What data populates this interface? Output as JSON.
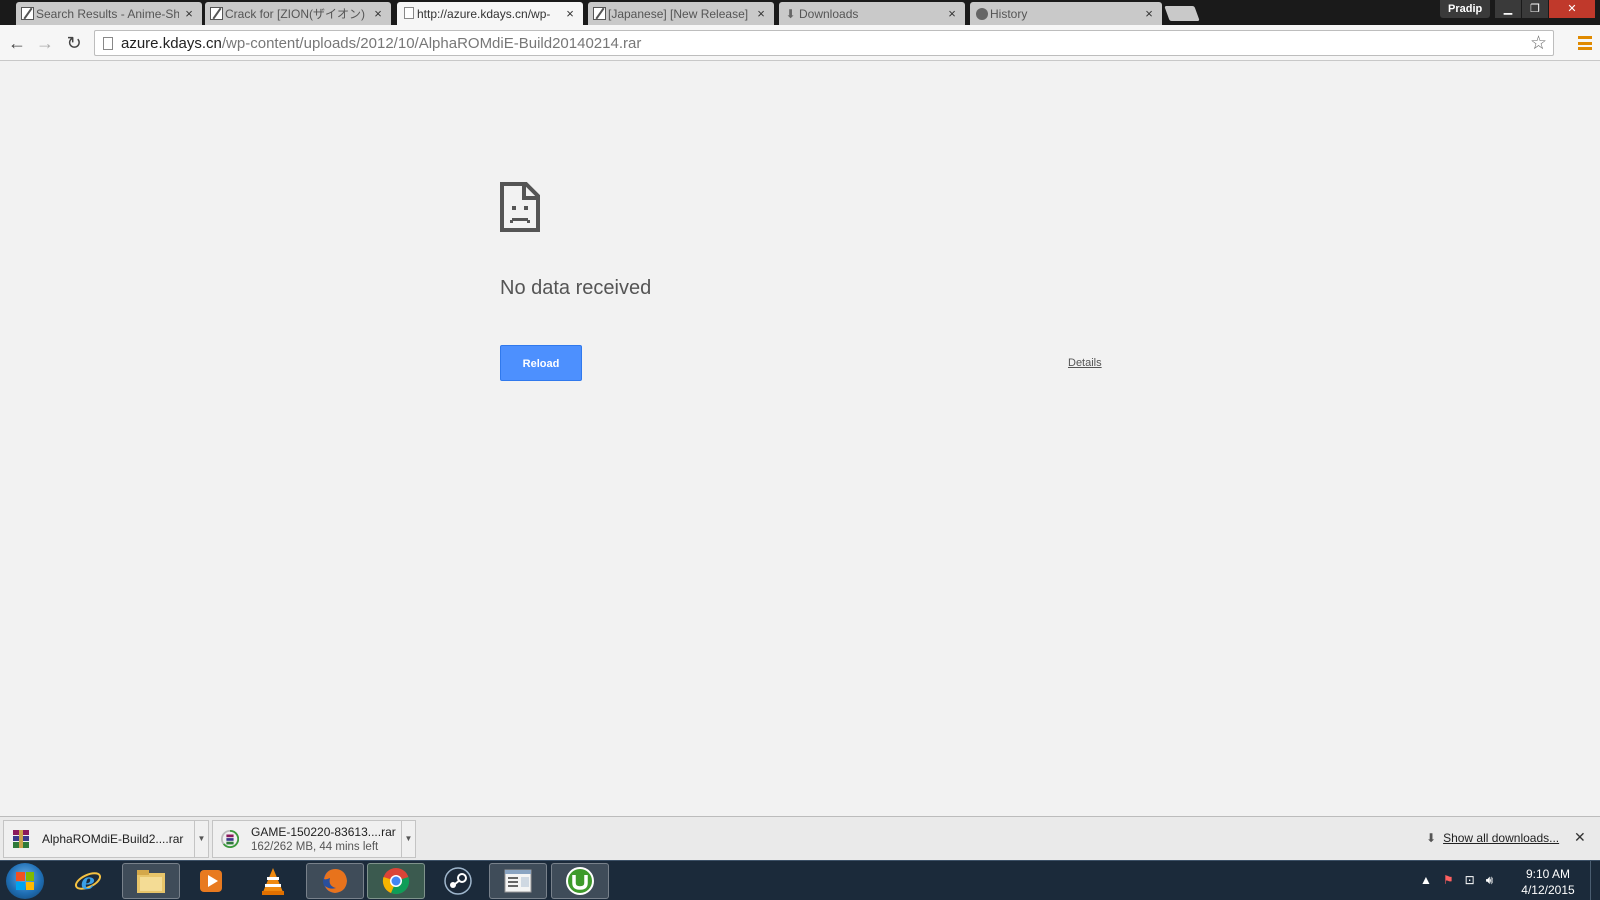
{
  "tabs": [
    {
      "title": "Search Results - Anime-Sh",
      "favicon": "z-logo-icon"
    },
    {
      "title": "Crack for [ZION(ザイオン)",
      "favicon": "z-logo-icon"
    },
    {
      "title": "http://azure.kdays.cn/wp-",
      "favicon": "page-icon",
      "active": true
    },
    {
      "title": "[Japanese] [New Release]",
      "favicon": "z-logo-icon"
    },
    {
      "title": "Downloads",
      "favicon": "download-icon"
    },
    {
      "title": "History",
      "favicon": "history-icon"
    }
  ],
  "profile_name": "Pradip",
  "omnibox": {
    "host": "azure.kdays.cn",
    "path": "/wp-content/uploads/2012/10/AlphaROMdiE-Build20140214.rar"
  },
  "error_page": {
    "title": "No data received",
    "reload_label": "Reload",
    "details_label": "Details"
  },
  "download_shelf": {
    "items": [
      {
        "name": "AlphaROMdiE-Build2....rar",
        "status": ""
      },
      {
        "name": "GAME-150220-83613....rar",
        "status": "162/262 MB, 44 mins left"
      }
    ],
    "show_all_label": "Show all downloads..."
  },
  "taskbar": {
    "apps": [
      "internet-explorer-icon",
      "file-explorer-icon",
      "media-player-icon",
      "vlc-icon",
      "firefox-icon",
      "chrome-icon",
      "steam-icon",
      "notepad-window-icon",
      "utorrent-icon"
    ],
    "time": "9:10 AM",
    "date": "4/12/2015"
  },
  "colors": {
    "reload_button": "#4d90fe",
    "menu_icon": "#e08a00",
    "taskbar": "#1b2a3a"
  }
}
